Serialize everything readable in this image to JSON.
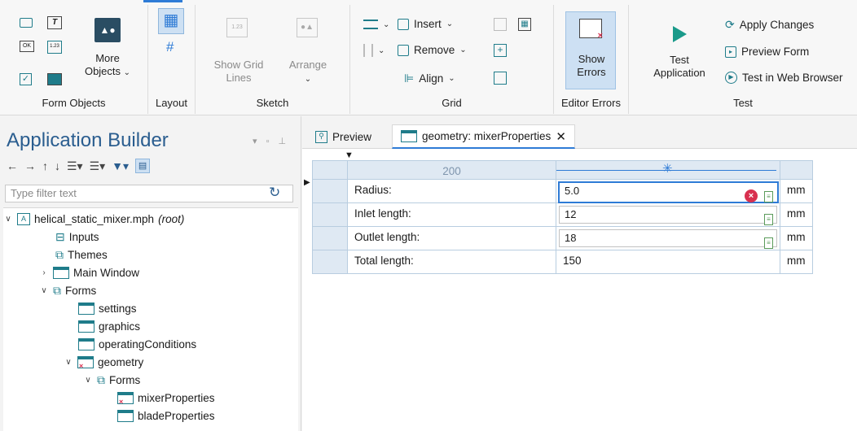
{
  "ribbon": {
    "groups": {
      "form_objects": "Form Objects",
      "layout": "Layout",
      "sketch": "Sketch",
      "grid": "Grid",
      "editor_errors": "Editor Errors",
      "test": "Test"
    },
    "more_objects": "More Objects",
    "show_grid_lines": "Show Grid Lines",
    "arrange": "Arrange",
    "insert": "Insert",
    "remove": "Remove",
    "align": "Align",
    "show_errors": "Show Errors",
    "test_application": "Test Application",
    "apply_changes": "Apply Changes",
    "preview_form": "Preview Form",
    "test_in_web_browser": "Test in Web Browser",
    "colors": {
      "accent": "#2e7bd6",
      "play": "#1a9a8a"
    }
  },
  "app_builder": {
    "title": "Application Builder",
    "filter_placeholder": "Type filter text",
    "tree": [
      {
        "label": "helical_static_mixer.mph",
        "suffix": "(root)"
      },
      {
        "label": "Inputs"
      },
      {
        "label": "Themes"
      },
      {
        "label": "Main Window"
      },
      {
        "label": "Forms"
      },
      {
        "label": "settings"
      },
      {
        "label": "graphics"
      },
      {
        "label": "operatingConditions"
      },
      {
        "label": "geometry"
      },
      {
        "label": "Forms"
      },
      {
        "label": "mixerProperties"
      },
      {
        "label": "bladeProperties"
      }
    ]
  },
  "editor": {
    "tabs": [
      {
        "label": "Preview"
      },
      {
        "label": "geometry: mixerProperties"
      }
    ],
    "column_width": "200",
    "rows": [
      {
        "label": "Radius:",
        "value": "5.0",
        "unit": "mm"
      },
      {
        "label": "Inlet length:",
        "value": "12",
        "unit": "mm"
      },
      {
        "label": "Outlet length:",
        "value": "18",
        "unit": "mm"
      },
      {
        "label": "Total length:",
        "value": "150",
        "unit": "mm"
      }
    ]
  }
}
